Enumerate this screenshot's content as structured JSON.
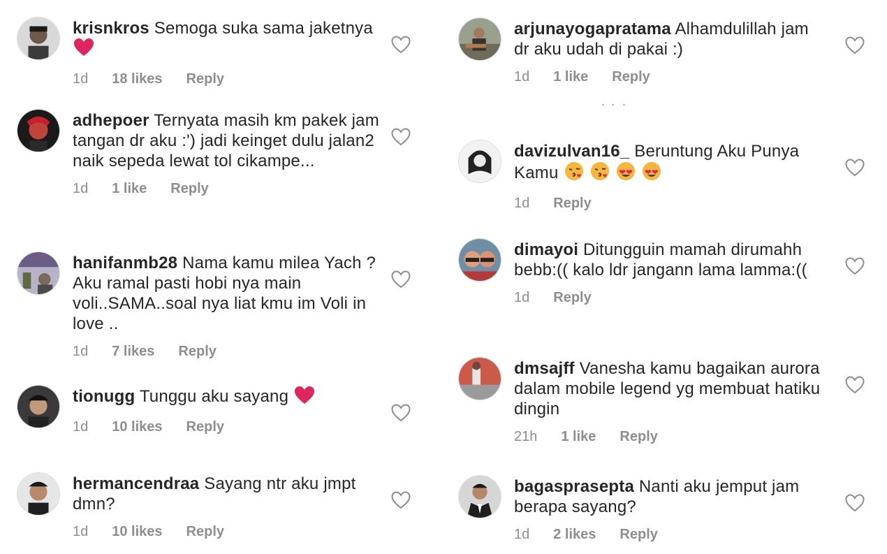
{
  "left_comments": [
    {
      "username": "krisnkros",
      "text": "Semoga suka sama jaketnya",
      "emoji": "red-heart",
      "time": "1d",
      "likes": "18 likes",
      "reply": "Reply"
    },
    {
      "username": "adhepoer",
      "text": "Ternyata masih km pakek jam tangan dr aku :') jadi keinget dulu jalan2 naik sepeda lewat tol cikampe...",
      "emoji": "",
      "time": "1d",
      "likes": "1 like",
      "reply": "Reply"
    },
    {
      "username": "hanifanmb28",
      "text": "Nama kamu milea Yach ? Aku ramal pasti hobi nya main voli..SAMA..soal nya liat kmu im Voli in love ..",
      "emoji": "",
      "time": "1d",
      "likes": "7 likes",
      "reply": "Reply"
    },
    {
      "username": "tionugg",
      "text": "Tunggu aku sayang",
      "emoji": "red-heart",
      "time": "1d",
      "likes": "10 likes",
      "reply": "Reply"
    },
    {
      "username": "hermancendraa",
      "text": "Sayang ntr aku jmpt dmn?",
      "emoji": "",
      "time": "1d",
      "likes": "10 likes",
      "reply": "Reply"
    }
  ],
  "right_comments": [
    {
      "username": "arjunayogapratama",
      "text": "Alhamdulillah jam dr aku udah di pakai :)",
      "emoji": "",
      "time": "1d",
      "likes": "1 like",
      "reply": "Reply"
    },
    {
      "username": "davizulvan16_",
      "text": "Beruntung Aku Punya Kamu",
      "emoji": "kiss-kiss-hearteyes-hearteyes",
      "time": "1d",
      "likes": "",
      "reply": "Reply"
    },
    {
      "username": "dimayoi",
      "text": "Ditungguin mamah dirumahh bebb:(( kalo ldr jangann lama lamma:((",
      "emoji": "",
      "time": "1d",
      "likes": "",
      "reply": "Reply"
    },
    {
      "username": "dmsajff",
      "text": "Vanesha kamu bagaikan aurora dalam mobile legend yg membuat hatiku dingin",
      "emoji": "",
      "time": "21h",
      "likes": "1 like",
      "reply": "Reply"
    },
    {
      "username": "bagasprasepta",
      "text": "Nanti aku jemput jam berapa sayang?",
      "emoji": "",
      "time": "1d",
      "likes": "2 likes",
      "reply": "Reply"
    }
  ],
  "colors": {
    "text": "#262626",
    "meta": "#8e8e8e",
    "heart_outline": "#8e8e8e",
    "emoji_red": "#e0245e"
  }
}
